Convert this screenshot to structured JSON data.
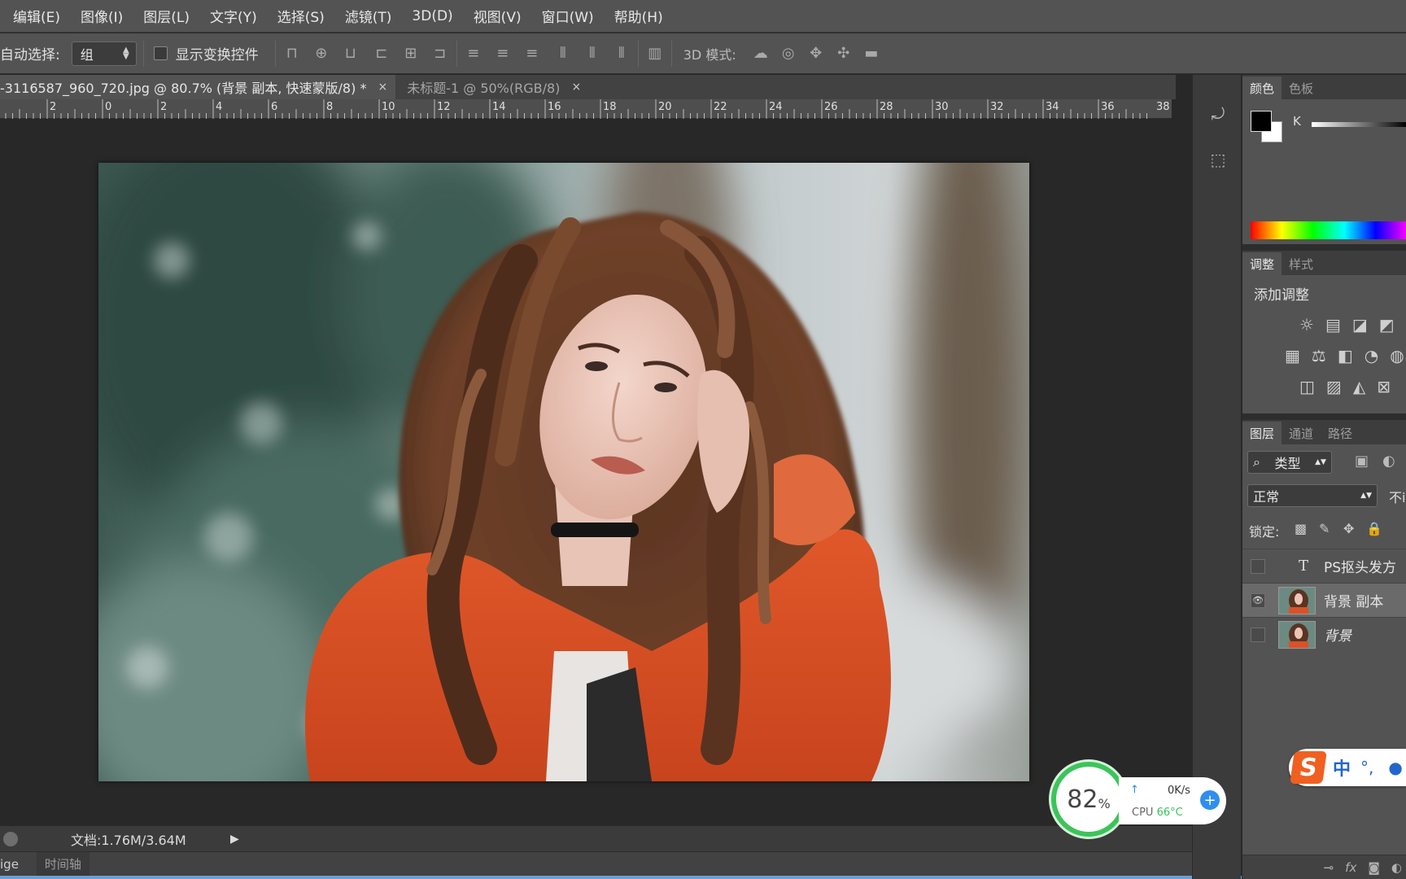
{
  "menu": [
    "编辑(E)",
    "图像(I)",
    "图层(L)",
    "文字(Y)",
    "选择(S)",
    "滤镜(T)",
    "3D(D)",
    "视图(V)",
    "窗口(W)",
    "帮助(H)"
  ],
  "options": {
    "auto_select_label": "自动选择:",
    "auto_select_value": "组",
    "show_transform_label": "显示变换控件",
    "mode_3d_label": "3D 模式:"
  },
  "tabs": [
    {
      "label": "-3116587_960_720.jpg @ 80.7% (背景 副本, 快速蒙版/8) *",
      "close": "×"
    },
    {
      "label": "未标题-1 @ 50%(RGB/8)",
      "close": "×"
    }
  ],
  "ruler_ticks": [
    "2",
    "0",
    "2",
    "4",
    "6",
    "8",
    "10",
    "12",
    "14",
    "16",
    "18",
    "20",
    "22",
    "24",
    "26",
    "28",
    "30",
    "32",
    "34",
    "36",
    "38"
  ],
  "status": {
    "doc_info": "文档:1.76M/3.64M",
    "play": "▶"
  },
  "timeline": {
    "left_label": "ige",
    "tab_label": "时间轴"
  },
  "color_panel": {
    "tabs": [
      "颜色",
      "色板"
    ],
    "channel_label": "K"
  },
  "adjust_panel": {
    "tabs": [
      "调整",
      "样式"
    ],
    "title": "添加调整"
  },
  "layers_panel": {
    "tabs": [
      "图层",
      "通道",
      "路径"
    ],
    "filter_value": "类型",
    "blend_mode": "正常",
    "opacity_label_partial": "不i",
    "lock_label": "锁定:",
    "layers": [
      {
        "name": "PS抠头发方",
        "type": "text",
        "visible": false
      },
      {
        "name": "背景 副本",
        "type": "image",
        "visible": true,
        "selected": true
      },
      {
        "name": "背景",
        "type": "image",
        "visible": false
      }
    ],
    "footer_icons": [
      "link-icon",
      "fx-icon",
      "mask-icon",
      "adjustment-icon"
    ]
  },
  "speed_widget": {
    "percent": "82",
    "unit": "%",
    "net_speed": "0K/s",
    "cpu_label": "CPU",
    "cpu_temp": "66°C"
  },
  "ime": {
    "logo": "S",
    "mode": "中",
    "punct": "°,",
    "mic": "🎙"
  },
  "colors": {
    "ui_dark": "#282828",
    "ui_panel": "#535353",
    "accent_green": "#3cc45a",
    "ime_orange": "#f06020"
  }
}
